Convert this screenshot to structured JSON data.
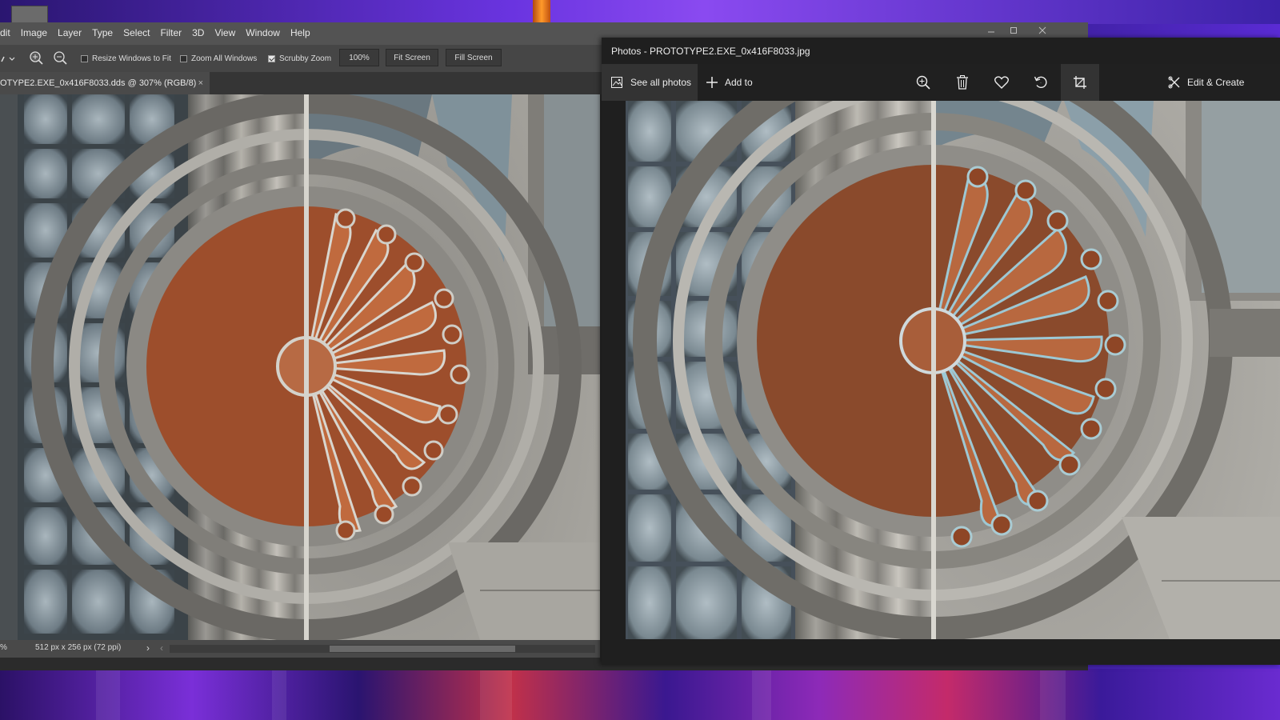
{
  "photoshop": {
    "menu": [
      "dit",
      "Image",
      "Layer",
      "Type",
      "Select",
      "Filter",
      "3D",
      "View",
      "Window",
      "Help"
    ],
    "options": {
      "resize_windows_label": "Resize Windows to Fit",
      "resize_windows_checked": false,
      "zoom_all_label": "Zoom All Windows",
      "zoom_all_checked": false,
      "scrubby_label": "Scrubby Zoom",
      "scrubby_checked": true,
      "zoom_value": "100%",
      "fit_screen_label": "Fit Screen",
      "fill_screen_label": "Fill Screen"
    },
    "tab": {
      "title": "OTYPE2.EXE_0x416F8033.dds @ 307% (RGB/8)",
      "close": "×"
    },
    "status": {
      "zoom": "%",
      "doc_info": "512 px x 256 px (72 ppi)",
      "arrow": "›",
      "scroll_left": "‹"
    },
    "window_controls": [
      "minimize-icon",
      "maximize-icon",
      "close-icon"
    ]
  },
  "photos": {
    "title": "Photos - PROTOTYPE2.EXE_0x416F8033.jpg",
    "toolbar": {
      "see_all_label": "See all photos",
      "add_to_label": "Add to",
      "edit_create_label": "Edit & Create",
      "icons": [
        "zoom-in-icon",
        "delete-icon",
        "favorite-icon",
        "rotate-icon",
        "crop-icon"
      ]
    }
  }
}
